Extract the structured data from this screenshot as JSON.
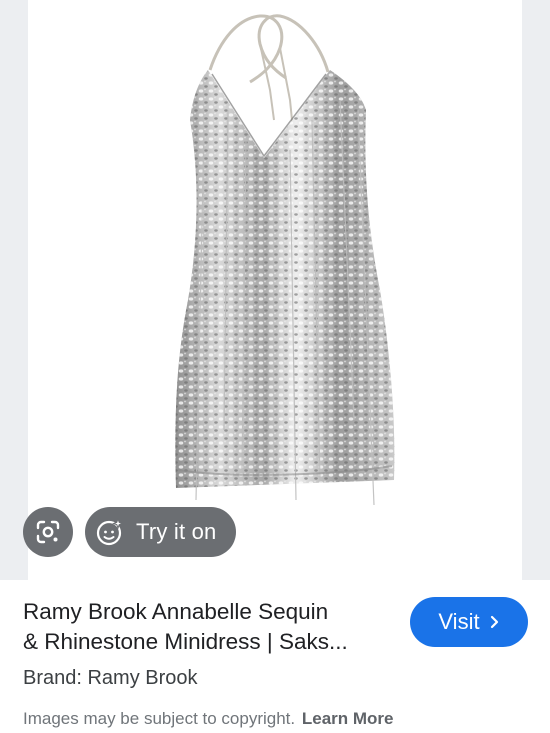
{
  "product": {
    "title_line1": "Ramy Brook Annabelle Sequin",
    "title_line2": "& Rhinestone Minidress | Saks...",
    "brand": "Brand: Ramy Brook",
    "image_icon": "sequin-minidress-image"
  },
  "actions": {
    "lens_icon": "google-lens-icon",
    "try_on_label": "Try it on",
    "try_on_icon": "try-on-face-icon",
    "visit_label": "Visit",
    "visit_icon": "chevron-right-icon"
  },
  "footer": {
    "copyright_text": "Images may be subject to copyright.",
    "learn_more_label": "Learn More"
  },
  "colors": {
    "visit_button": "#1a73e8",
    "overlay_button": "#6b6e72",
    "side_background": "#eceef1"
  }
}
